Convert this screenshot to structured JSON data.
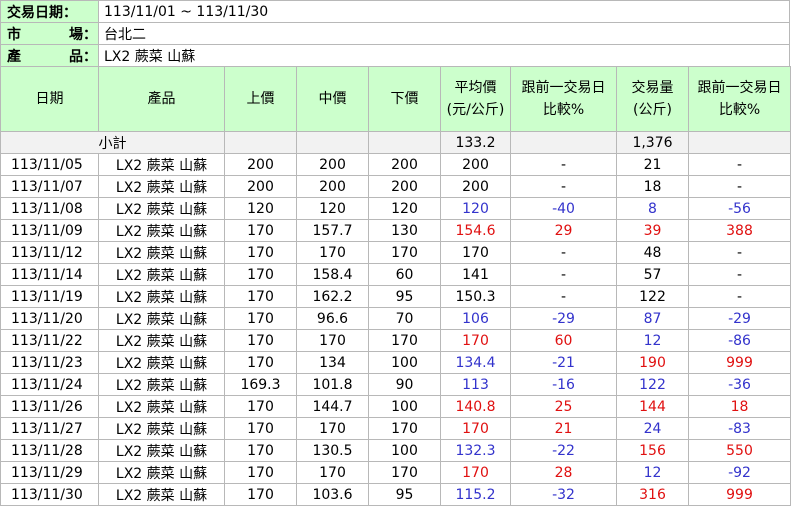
{
  "info": {
    "date_label": "交易日期：",
    "date_value": "113/11/01 ~ 113/11/30",
    "market_label": [
      "市",
      "場："
    ],
    "market_value": "台北二",
    "product_label": [
      "產",
      "品："
    ],
    "product_value": "LX2 蕨菜 山蘇"
  },
  "headers": {
    "date": "日期",
    "product": "產品",
    "upper": "上價",
    "middle": "中價",
    "lower": "下價",
    "avg_line1": "平均價",
    "avg_line2": "(元/公斤)",
    "cmp1_line1": "跟前一交易日",
    "cmp1_line2": "比較%",
    "vol_line1": "交易量",
    "vol_line2": "(公斤)",
    "cmp2_line1": "跟前一交易日",
    "cmp2_line2": "比較%"
  },
  "subtotal": {
    "label": "小計",
    "avg": "133.2",
    "volume": "1,376"
  },
  "colors": {
    "header_bg": "#ccffcc",
    "up": "#e01010",
    "down": "#3333cc"
  },
  "rows": [
    {
      "date": "113/11/05",
      "product": "LX2 蕨菜 山蘇",
      "upper": "200",
      "middle": "200",
      "lower": "200",
      "avg": "200",
      "cmp_price": "-",
      "volume": "21",
      "cmp_vol": "-",
      "price_trend": "none",
      "vol_trend": "none"
    },
    {
      "date": "113/11/07",
      "product": "LX2 蕨菜 山蘇",
      "upper": "200",
      "middle": "200",
      "lower": "200",
      "avg": "200",
      "cmp_price": "-",
      "volume": "18",
      "cmp_vol": "-",
      "price_trend": "none",
      "vol_trend": "none"
    },
    {
      "date": "113/11/08",
      "product": "LX2 蕨菜 山蘇",
      "upper": "120",
      "middle": "120",
      "lower": "120",
      "avg": "120",
      "cmp_price": "-40",
      "volume": "8",
      "cmp_vol": "-56",
      "price_trend": "down",
      "vol_trend": "down"
    },
    {
      "date": "113/11/09",
      "product": "LX2 蕨菜 山蘇",
      "upper": "170",
      "middle": "157.7",
      "lower": "130",
      "avg": "154.6",
      "cmp_price": "29",
      "volume": "39",
      "cmp_vol": "388",
      "price_trend": "up",
      "vol_trend": "up"
    },
    {
      "date": "113/11/12",
      "product": "LX2 蕨菜 山蘇",
      "upper": "170",
      "middle": "170",
      "lower": "170",
      "avg": "170",
      "cmp_price": "-",
      "volume": "48",
      "cmp_vol": "-",
      "price_trend": "none",
      "vol_trend": "none"
    },
    {
      "date": "113/11/14",
      "product": "LX2 蕨菜 山蘇",
      "upper": "170",
      "middle": "158.4",
      "lower": "60",
      "avg": "141",
      "cmp_price": "-",
      "volume": "57",
      "cmp_vol": "-",
      "price_trend": "none",
      "vol_trend": "none"
    },
    {
      "date": "113/11/19",
      "product": "LX2 蕨菜 山蘇",
      "upper": "170",
      "middle": "162.2",
      "lower": "95",
      "avg": "150.3",
      "cmp_price": "-",
      "volume": "122",
      "cmp_vol": "-",
      "price_trend": "none",
      "vol_trend": "none"
    },
    {
      "date": "113/11/20",
      "product": "LX2 蕨菜 山蘇",
      "upper": "170",
      "middle": "96.6",
      "lower": "70",
      "avg": "106",
      "cmp_price": "-29",
      "volume": "87",
      "cmp_vol": "-29",
      "price_trend": "down",
      "vol_trend": "down"
    },
    {
      "date": "113/11/22",
      "product": "LX2 蕨菜 山蘇",
      "upper": "170",
      "middle": "170",
      "lower": "170",
      "avg": "170",
      "cmp_price": "60",
      "volume": "12",
      "cmp_vol": "-86",
      "price_trend": "up",
      "vol_trend": "down"
    },
    {
      "date": "113/11/23",
      "product": "LX2 蕨菜 山蘇",
      "upper": "170",
      "middle": "134",
      "lower": "100",
      "avg": "134.4",
      "cmp_price": "-21",
      "volume": "190",
      "cmp_vol": "999",
      "price_trend": "down",
      "vol_trend": "up"
    },
    {
      "date": "113/11/24",
      "product": "LX2 蕨菜 山蘇",
      "upper": "169.3",
      "middle": "101.8",
      "lower": "90",
      "avg": "113",
      "cmp_price": "-16",
      "volume": "122",
      "cmp_vol": "-36",
      "price_trend": "down",
      "vol_trend": "down"
    },
    {
      "date": "113/11/26",
      "product": "LX2 蕨菜 山蘇",
      "upper": "170",
      "middle": "144.7",
      "lower": "100",
      "avg": "140.8",
      "cmp_price": "25",
      "volume": "144",
      "cmp_vol": "18",
      "price_trend": "up",
      "vol_trend": "up"
    },
    {
      "date": "113/11/27",
      "product": "LX2 蕨菜 山蘇",
      "upper": "170",
      "middle": "170",
      "lower": "170",
      "avg": "170",
      "cmp_price": "21",
      "volume": "24",
      "cmp_vol": "-83",
      "price_trend": "up",
      "vol_trend": "down"
    },
    {
      "date": "113/11/28",
      "product": "LX2 蕨菜 山蘇",
      "upper": "170",
      "middle": "130.5",
      "lower": "100",
      "avg": "132.3",
      "cmp_price": "-22",
      "volume": "156",
      "cmp_vol": "550",
      "price_trend": "down",
      "vol_trend": "up"
    },
    {
      "date": "113/11/29",
      "product": "LX2 蕨菜 山蘇",
      "upper": "170",
      "middle": "170",
      "lower": "170",
      "avg": "170",
      "cmp_price": "28",
      "volume": "12",
      "cmp_vol": "-92",
      "price_trend": "up",
      "vol_trend": "down"
    },
    {
      "date": "113/11/30",
      "product": "LX2 蕨菜 山蘇",
      "upper": "170",
      "middle": "103.6",
      "lower": "95",
      "avg": "115.2",
      "cmp_price": "-32",
      "volume": "316",
      "cmp_vol": "999",
      "price_trend": "down",
      "vol_trend": "up"
    }
  ]
}
